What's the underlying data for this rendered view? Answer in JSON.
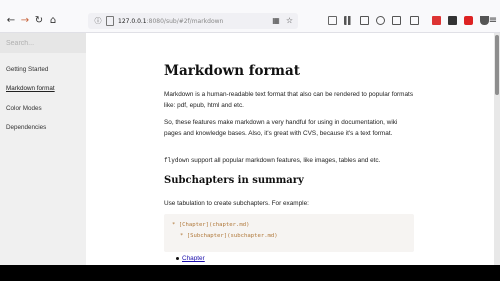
{
  "browser": {
    "url_host": "127.0.0.1",
    "url_rest": ":8080/sub/#2f/markdown",
    "nav_icons": [
      "back-icon",
      "forward-icon",
      "reload-icon",
      "home-icon"
    ],
    "url_icons": [
      "bookmark-icon",
      "star-icon"
    ],
    "extension_icons": [
      "library-icon",
      "books-icon",
      "sidebar-icon",
      "account-icon",
      "extension-red-icon",
      "extension-icon",
      "extension-square-icon",
      "shield-icon",
      "menu-icon"
    ]
  },
  "sidebar": {
    "search_placeholder": "Search...",
    "items": [
      {
        "label": "Getting Started",
        "active": false
      },
      {
        "label": "Markdown format",
        "active": true
      },
      {
        "label": "Color Modes",
        "active": false
      },
      {
        "label": "Dependencies",
        "active": false
      }
    ]
  },
  "content": {
    "title": "Markdown format",
    "para1": "Markdown is a human-readable text format that also can be rendered to popular formats like: pdf, epub, html and etc.",
    "para2": "So, these features make markdown a very handful for using in documentation, wiki pages and knowledge bases. Also, it's great with CVS, because it's a text format.",
    "para3_code": "flydown",
    "para3_rest": " support all popular markdown features, like images, tables and etc.",
    "subtitle": "Subchapters in summary",
    "para4": "Use tabulation to create subchapters. For example:",
    "code_line1": "* [Chapter](chapter.md)",
    "code_line2": "* [Subchapter](subchapter.md)",
    "list_link": "Chapter"
  },
  "colors": {
    "accent_link": "#1a0dab",
    "code_text": "#b0783a",
    "sidebar_bg": "#f0f0f0"
  }
}
